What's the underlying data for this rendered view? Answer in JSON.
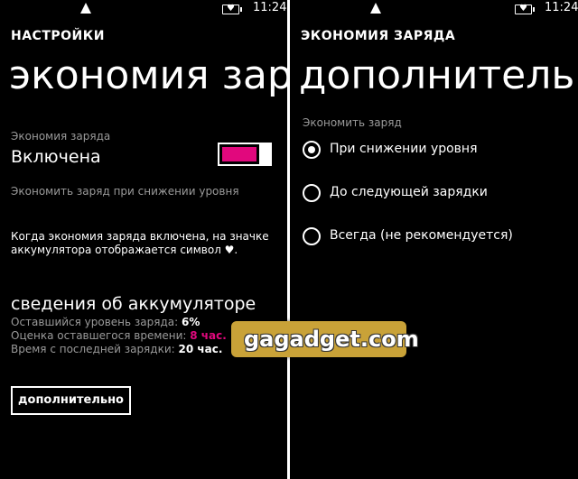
{
  "left": {
    "status": {
      "time": "11:24"
    },
    "app_title": "НАСТРОЙКИ",
    "page_title": "экономия заряда",
    "saver_label": "Экономия заряда",
    "saver_state": "Включена",
    "saver_toggle_on": true,
    "accent_color": "#e1087d",
    "saver_mode_text": "Экономить заряд при снижении уровня",
    "info_line1": "Когда экономия заряда включена, на значке",
    "info_line2": "аккумулятора отображается символ ♥.",
    "battery_info": {
      "heading": "сведения об аккумуляторе",
      "level_label": "Оставшийся уровень заряда:",
      "level_value": "6%",
      "time_left_label": "Оценка оставшегося времени:",
      "time_left_value": "8 час.",
      "since_charge_label": "Время с последней зарядки:",
      "since_charge_value": "20 час."
    },
    "advanced_button": "дополнительно"
  },
  "right": {
    "status": {
      "time": "11:24"
    },
    "app_title": "ЭКОНОМИЯ ЗАРЯДА",
    "page_title": "дополнительно",
    "section_label": "Экономить заряд",
    "options": [
      {
        "label": "При снижении уровня",
        "selected": true
      },
      {
        "label": "До следующей зарядки",
        "selected": false
      },
      {
        "label": "Всегда (не рекомендуется)",
        "selected": false
      }
    ]
  },
  "watermark": "gagadget.com"
}
